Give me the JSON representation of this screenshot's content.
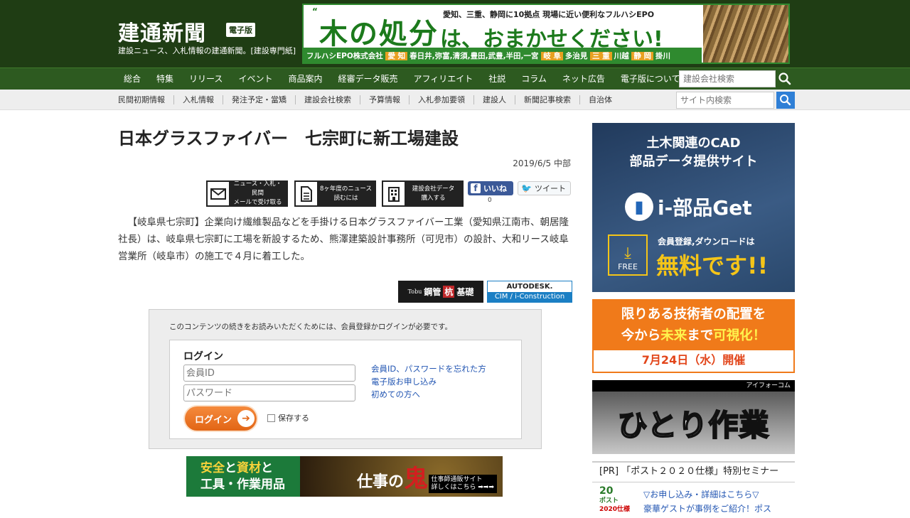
{
  "header": {
    "logo": "建通新聞",
    "edition_badge": "電子版",
    "tagline": "建設ニュース、入札情報の建通新聞。[建設専門紙]",
    "banner": {
      "quote_open": "“",
      "headline": "木の処分",
      "quote_close": "”",
      "copy": "は、おまかせください!",
      "small": "愛知、三重、静岡に10拠点 現場に近い便利なフルハシEPO",
      "company": "フルハシEPO株式会社",
      "locations_aichi_tag": "愛 知",
      "locations_aichi": "春日井,弥富,清須,豊田,武豊,半田,一宮",
      "locations_gifu_tag": "岐 阜",
      "locations_gifu": "多治見",
      "locations_mie_tag": "三 重",
      "locations_mie": "川越",
      "locations_shizuoka_tag": "静 岡",
      "locations_shizuoka": "掛川"
    }
  },
  "nav_primary": [
    "総合",
    "特集",
    "リリース",
    "イベント",
    "商品案内",
    "経審データ販売",
    "アフィリエイト",
    "社説",
    "コラム",
    "ネット広告",
    "電子版について"
  ],
  "search_company": {
    "placeholder": "建設会社検索"
  },
  "nav_secondary": [
    "民間初期情報",
    "入札情報",
    "発注予定・當矯",
    "建設会社検索",
    "予算情報",
    "入札参加要領",
    "建設人",
    "新聞記事検索",
    "自治体"
  ],
  "search_site": {
    "placeholder": "サイト内検索"
  },
  "article": {
    "title": "日本グラスファイバー　七宗町に新工場建設",
    "date": "2019/6/5",
    "region": "中部",
    "share": {
      "mail_line1": "ニュース・入札・民間",
      "mail_line2": "メールで受け取る",
      "news_line1": "8ヶ年度のニュース",
      "news_line2": "読むには",
      "company_line1": "建設会社データ",
      "company_line2": "購入する",
      "like_label": "いいね",
      "like_count": "0",
      "tweet_label": "ツイート"
    },
    "body": "【岐阜県七宗町】企業向け繊維製品などを手掛ける日本グラスファイバー工業（愛知県江南市、朝居隆社長）は、岐阜県七宗町に工場を新設するため、熊澤建築設計事務所（可児市）の設計、大和リース岐阜営業所（岐阜市）の施工で４月に着工した。",
    "sponsor1": {
      "brand": "Tobu",
      "text1": "鋼管",
      "text2": "杭",
      "text3": "基礎"
    },
    "sponsor2": {
      "line1": "AUTODESK.",
      "line2": "CIM / i-Construction"
    }
  },
  "gate": {
    "message": "このコンテンツの続きをお読みいただくためには、会員登録かログインが必要です。",
    "login_heading": "ログイン",
    "member_id_placeholder": "会員ID",
    "password_placeholder": "パスワード",
    "login_button": "ログイン",
    "remember_label": "保存する",
    "links": [
      "会員ID、パスワードを忘れた方",
      "電子版お申し込み",
      "初めての方へ"
    ]
  },
  "ad_bottom": {
    "line1a": "安全",
    "line1b": "と",
    "line1c": "資材",
    "line1d": "と",
    "line2": "工具・作業用品",
    "brand_a": "仕事の",
    "brand_b": "鬼",
    "site_line1": "仕事師通販サイト",
    "site_line2": "詳しくはこちら ➡➡➡"
  },
  "sidebar": {
    "cad": {
      "title_line1": "土木関連のCAD",
      "title_line2": "部品データ提供サイト",
      "logo": "i-部品Get",
      "free": "FREE",
      "register": "会員登録,ダウンロードは",
      "free_big": "無料です!!"
    },
    "event": {
      "line1": "限りある技術者の配置を",
      "line2a": "今から",
      "line2b": "未来",
      "line2c": "まで",
      "line2d": "可視化！",
      "date": "7月24日（水）開催"
    },
    "solo": {
      "brand": "アイフォーコム",
      "text": "ひとり作業"
    },
    "pr": {
      "heading": "[PR] 「ポスト２０２０仕様」特別セミナー",
      "thumb_line1": "20",
      "thumb_line2": "ポスト",
      "thumb_line3": "2020仕様",
      "link": "▽お申し込み・詳細はこちら▽",
      "sub": "豪華ゲストが事例をご紹介！ポス"
    }
  },
  "colors": {
    "header_bg": "#1f3d14",
    "nav_bg": "#2d5a20",
    "accent_orange": "#f07a1a",
    "link_blue": "#2457b3"
  }
}
